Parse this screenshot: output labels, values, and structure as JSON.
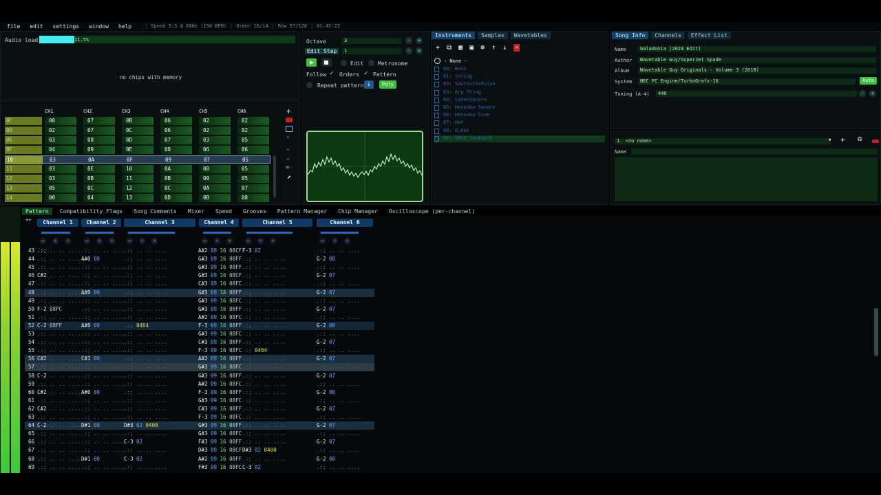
{
  "menu": {
    "file": "file",
    "edit": "edit",
    "settings": "settings",
    "window": "window",
    "help": "help"
  },
  "status": {
    "speed": "Speed 3:3 @ 60Hz (150 BPM)",
    "order": "Order 10/14",
    "row": "Row 57/128",
    "time": "01:45:22"
  },
  "audio": {
    "label": "Audio load",
    "percent": "11.5%",
    "load": 0.115
  },
  "chips": {
    "message": "no chips with memory"
  },
  "controls": {
    "octave_label": "Octave",
    "octave": "3",
    "editstep_label": "Edit Step",
    "editstep": "1",
    "edit": "Edit",
    "metronome": "Metronome",
    "follow": "Follow",
    "orders": "Orders",
    "pattern": "Pattern",
    "repeat": "Repeat pattern",
    "poly": "Poly"
  },
  "orders": {
    "headers": [
      "CH1",
      "CH2",
      "CH3",
      "CH4",
      "CH5",
      "CH6"
    ],
    "rows": [
      {
        "n": "0C",
        "v": [
          "00",
          "07",
          "0B",
          "06",
          "02",
          "02"
        ]
      },
      {
        "n": "0D",
        "v": [
          "02",
          "07",
          "0C",
          "06",
          "02",
          "02"
        ]
      },
      {
        "n": "0E",
        "v": [
          "03",
          "08",
          "0D",
          "07",
          "03",
          "05"
        ]
      },
      {
        "n": "0F",
        "v": [
          "04",
          "09",
          "0E",
          "08",
          "06",
          "06"
        ]
      },
      {
        "n": "10",
        "v": [
          "03",
          "0A",
          "0F",
          "09",
          "07",
          "05"
        ]
      },
      {
        "n": "11",
        "v": [
          "03",
          "0E",
          "10",
          "0A",
          "08",
          "05"
        ]
      },
      {
        "n": "12",
        "v": [
          "03",
          "0B",
          "11",
          "0B",
          "09",
          "05"
        ]
      },
      {
        "n": "13",
        "v": [
          "05",
          "0C",
          "12",
          "0C",
          "0A",
          "07"
        ]
      },
      {
        "n": "14",
        "v": [
          "00",
          "04",
          "13",
          "0D",
          "0B",
          "08"
        ]
      }
    ]
  },
  "instruments": {
    "tabs": [
      "Instruments",
      "Samples",
      "Wavetables"
    ],
    "none": "- None -",
    "items": [
      "00: Bass",
      "01: String",
      "02: Sawtooth+Pulse",
      "03: Arp Thing",
      "04: Sine+Square",
      "05: Hensoku Square",
      "06: Hensoku Sine",
      "07: Hat",
      "08: O.Hat",
      "09: VRC6 Sawtooth"
    ]
  },
  "songinfo": {
    "tabs": [
      "Song Info",
      "Channels",
      "Effect List"
    ],
    "name_label": "Name",
    "name": "Galadonia (2024 Edit)",
    "author_label": "Author",
    "author": "Wavetable Guy/SuperJet Spade",
    "album_label": "Album",
    "album": "Wavetable Guy Originals - Volume 3 (2018)",
    "system_label": "System",
    "system": "NEC PC Engine/TurboGrafx-16",
    "auto": "Auto",
    "tuning_label": "Tuning (A-4)",
    "tuning": "440"
  },
  "wave": {
    "selector": "1. <no name>",
    "name_label": "Name"
  },
  "ptabs": [
    "Pattern",
    "Compatibility Flags",
    "Song Comments",
    "Mixer",
    "Speed",
    "Grooves",
    "Pattern Manager",
    "Chip Manager",
    "Oscilloscope (per-channel)"
  ],
  "channels": [
    "Channel 1",
    "Channel 2",
    "Channel 3",
    "Channel 4",
    "Channel 5",
    "Channel 6"
  ],
  "pattern": [
    {
      "r": "43",
      "c": [
        [
          ".:;",
          ""
        ],
        [
          "",
          ""
        ],
        [
          "",
          ""
        ],
        [
          "A#2",
          "09 16 08CF"
        ],
        [
          "F-3",
          "02"
        ],
        [
          "",
          ""
        ]
      ]
    },
    {
      "r": "44",
      "c": [
        [
          "",
          ""
        ],
        [
          "A#0",
          "00"
        ],
        [
          "",
          ""
        ],
        [
          "G#3",
          "09 16 08FF"
        ],
        [
          "",
          ""
        ],
        [
          "G-2",
          "08"
        ]
      ]
    },
    {
      "r": "45",
      "c": [
        [
          "",
          ""
        ],
        [
          "",
          ""
        ],
        [
          "",
          ""
        ],
        [
          "G#3",
          "09 16 08FF"
        ],
        [
          "",
          ""
        ],
        [
          "",
          ""
        ]
      ]
    },
    {
      "r": "46",
      "c": [
        [
          "C#2",
          ""
        ],
        [
          "",
          ""
        ],
        [
          "",
          ""
        ],
        [
          "G#3",
          "09 16 08CF"
        ],
        [
          "",
          ""
        ],
        [
          "G-2",
          "07"
        ]
      ]
    },
    {
      "r": "47",
      "c": [
        [
          "",
          ""
        ],
        [
          "",
          ""
        ],
        [
          "",
          ""
        ],
        [
          "C#3",
          "09 16 08FC"
        ],
        [
          "",
          ""
        ],
        [
          "",
          ""
        ]
      ]
    },
    {
      "r": "48",
      "c": [
        [
          "",
          ""
        ],
        [
          "A#0",
          "00"
        ],
        [
          "",
          ""
        ],
        [
          "G#3",
          "09 1A 08FF"
        ],
        [
          "",
          ""
        ],
        [
          "G-2",
          "07"
        ]
      ]
    },
    {
      "r": "49",
      "c": [
        [
          "",
          ""
        ],
        [
          "",
          ""
        ],
        [
          "",
          ""
        ],
        [
          "G#3",
          "09 16 08FC"
        ],
        [
          "",
          ""
        ],
        [
          "",
          ""
        ]
      ]
    },
    {
      "r": "50",
      "c": [
        [
          "F-2",
          "08FC"
        ],
        [
          "",
          ""
        ],
        [
          "",
          ""
        ],
        [
          "G#3",
          "09 16 08FF"
        ],
        [
          "",
          ""
        ],
        [
          "G-2",
          "07"
        ]
      ]
    },
    {
      "r": "51",
      "c": [
        [
          "",
          ""
        ],
        [
          "",
          ""
        ],
        [
          "",
          ""
        ],
        [
          "A#2",
          "09 16 08FC"
        ],
        [
          "",
          ""
        ],
        [
          "",
          ""
        ]
      ]
    },
    {
      "r": "52",
      "c": [
        [
          "C-2",
          "08FF"
        ],
        [
          "A#0",
          "00"
        ],
        [
          "",
          "0464"
        ],
        [
          "F-3",
          "09 16 08FF"
        ],
        [
          "",
          ""
        ],
        [
          "G-2",
          "08"
        ]
      ]
    },
    {
      "r": "53",
      "c": [
        [
          "",
          ""
        ],
        [
          "",
          ""
        ],
        [
          "",
          ""
        ],
        [
          "G#3",
          "09 16 08FC"
        ],
        [
          "",
          ""
        ],
        [
          "",
          ""
        ]
      ]
    },
    {
      "r": "54",
      "c": [
        [
          "",
          ""
        ],
        [
          "",
          ""
        ],
        [
          "",
          ""
        ],
        [
          "C#3",
          "09 16 08FF"
        ],
        [
          "",
          ""
        ],
        [
          "G-2",
          "07"
        ]
      ]
    },
    {
      "r": "55",
      "c": [
        [
          "",
          ""
        ],
        [
          "",
          ""
        ],
        [
          "",
          ""
        ],
        [
          "F-3",
          "09 16 08FC"
        ],
        [
          "",
          "0464"
        ],
        [
          "",
          ""
        ]
      ]
    },
    {
      "r": "56",
      "c": [
        [
          "C#2",
          ""
        ],
        [
          "C#1",
          "00"
        ],
        [
          "",
          ""
        ],
        [
          "A#2",
          "09 16 08FF"
        ],
        [
          "",
          ""
        ],
        [
          "G-2",
          "07"
        ]
      ]
    },
    {
      "r": "57",
      "c": [
        [
          "",
          ""
        ],
        [
          "",
          ""
        ],
        [
          "",
          ""
        ],
        [
          "G#3",
          "09 16 08FC"
        ],
        [
          "",
          ""
        ],
        [
          "",
          ""
        ]
      ]
    },
    {
      "r": "58",
      "c": [
        [
          "C-2",
          ""
        ],
        [
          "",
          ""
        ],
        [
          "",
          ""
        ],
        [
          "G#3",
          "09 16 08FF"
        ],
        [
          "",
          ""
        ],
        [
          "G-2",
          "07"
        ]
      ]
    },
    {
      "r": "59",
      "c": [
        [
          "",
          ""
        ],
        [
          "",
          ""
        ],
        [
          "",
          ""
        ],
        [
          "A#2",
          "09 16 08FC"
        ],
        [
          "",
          ""
        ],
        [
          "",
          ""
        ]
      ]
    },
    {
      "r": "60",
      "c": [
        [
          "C#2",
          ""
        ],
        [
          "A#0",
          "00"
        ],
        [
          "",
          ""
        ],
        [
          "F-3",
          "09 16 08FF"
        ],
        [
          "",
          ""
        ],
        [
          "G-2",
          "08"
        ]
      ]
    },
    {
      "r": "61",
      "c": [
        [
          "",
          ""
        ],
        [
          "",
          ""
        ],
        [
          "",
          ""
        ],
        [
          "G#3",
          "09 16 08FC"
        ],
        [
          "",
          ""
        ],
        [
          "",
          ""
        ]
      ]
    },
    {
      "r": "62",
      "c": [
        [
          "C#2",
          ""
        ],
        [
          "",
          ""
        ],
        [
          "",
          ""
        ],
        [
          "C#3",
          "09 16 08FF"
        ],
        [
          "",
          ""
        ],
        [
          "G-2",
          "07"
        ]
      ]
    },
    {
      "r": "63",
      "c": [
        [
          "",
          ""
        ],
        [
          "",
          ""
        ],
        [
          "",
          ""
        ],
        [
          "F-3",
          "09 16 08FC"
        ],
        [
          "",
          ""
        ],
        [
          "",
          ""
        ]
      ]
    },
    {
      "r": "64",
      "c": [
        [
          "C-2",
          ""
        ],
        [
          "D#1",
          "00"
        ],
        [
          "D#3",
          "02 0400"
        ],
        [
          "G#3",
          "09 16 08FF"
        ],
        [
          "",
          ""
        ],
        [
          "G-2",
          "07"
        ]
      ]
    },
    {
      "r": "65",
      "c": [
        [
          "",
          ""
        ],
        [
          "",
          ""
        ],
        [
          "",
          ""
        ],
        [
          "G#3",
          "09 16 08FC"
        ],
        [
          "",
          ""
        ],
        [
          "",
          ""
        ]
      ]
    },
    {
      "r": "66",
      "c": [
        [
          "",
          ""
        ],
        [
          "",
          ""
        ],
        [
          "C-3",
          "02"
        ],
        [
          "F#3",
          "09 16 08FF"
        ],
        [
          "",
          ""
        ],
        [
          "G-2",
          "07"
        ]
      ]
    },
    {
      "r": "67",
      "c": [
        [
          "",
          ""
        ],
        [
          "",
          ""
        ],
        [
          "",
          ""
        ],
        [
          "D#3",
          "09 16 08CF"
        ],
        [
          "D#3",
          "02 0400"
        ],
        [
          "",
          ""
        ]
      ]
    },
    {
      "r": "68",
      "c": [
        [
          "",
          ""
        ],
        [
          "D#1",
          "00"
        ],
        [
          "C-3",
          "02"
        ],
        [
          "A#2",
          "09 16 08FF"
        ],
        [
          "",
          ""
        ],
        [
          "G-2",
          "08"
        ]
      ]
    },
    {
      "r": "69",
      "c": [
        [
          "",
          ""
        ],
        [
          "",
          ""
        ],
        [
          "",
          ""
        ],
        [
          "F#3",
          "09 16 08FC"
        ],
        [
          "C-3",
          "02"
        ],
        [
          "",
          ""
        ]
      ]
    }
  ],
  "colors": {
    "accent": "#2468c8",
    "green": "#8dff80",
    "load": "#3ff0f0",
    "vu_yellow": "#d8e830",
    "vu_green": "#3ec83e"
  }
}
